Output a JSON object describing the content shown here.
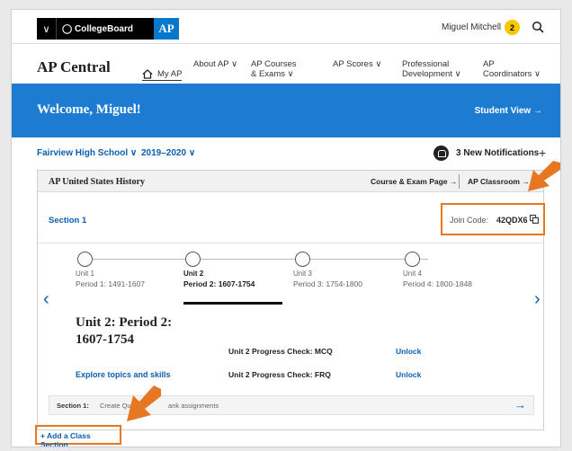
{
  "topbar": {
    "brand": "CollegeBoard",
    "ap_tag": "AP",
    "user_name": "Miguel Mitchell",
    "avatar_initial": "2"
  },
  "nav": {
    "brand_title": "AP Central",
    "items": [
      {
        "label": "My AP"
      },
      {
        "label_line1": "",
        "label_line2": "About AP ∨"
      },
      {
        "label_line1": "AP Courses",
        "label_line2": "& Exams  ∨"
      },
      {
        "label_line1": "",
        "label_line2": "AP Scores ∨"
      },
      {
        "label_line1": "Professional",
        "label_line2": "Development ∨"
      },
      {
        "label_line1": "AP",
        "label_line2": "Coordinators ∨"
      }
    ]
  },
  "banner": {
    "welcome": "Welcome, Miguel!",
    "student_view": "Student View →"
  },
  "filters": {
    "school": "Fairview High School ∨",
    "year": "2019–2020 ∨",
    "notifications": "3 New Notifications",
    "plus": "+"
  },
  "course": {
    "title": "AP United States History",
    "course_page": "Course & Exam Page →",
    "ap_classroom": "AP Classroom →",
    "section": "Section 1",
    "join_label": "Join Code:",
    "join_code": "42QDX6",
    "units": [
      {
        "name": "Unit 1",
        "period": "Period 1: 1491-1607"
      },
      {
        "name": "Unit 2",
        "period": "Period 2: 1607-1754"
      },
      {
        "name": "Unit 3",
        "period": "Period 3: 1754-1800"
      },
      {
        "name": "Unit 4",
        "period": "Period 4: 1800-1848"
      }
    ],
    "detail_title": "Unit 2: Period 2: 1607-1754",
    "explore_link": "Explore topics and skills",
    "checks": [
      {
        "label": "Unit 2 Progress Check: MCQ",
        "action": "Unlock"
      },
      {
        "label": "Unit 2 Progress Check: FRQ",
        "action": "Unlock"
      }
    ],
    "assign_label": "Section 1:",
    "assign_text": "Create Quiz",
    "assign_text_tail": "ank assignments"
  },
  "add_section": "+ Add a Class Section",
  "colors": {
    "brand_blue": "#1d7bd1",
    "link_blue": "#0a5fb0",
    "callout_orange": "#e87722",
    "avatar_yellow": "#f7c800"
  }
}
